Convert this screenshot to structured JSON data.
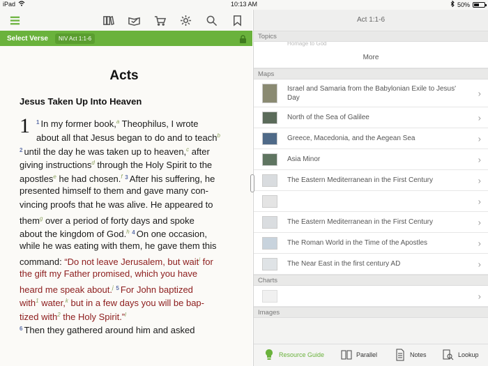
{
  "status": {
    "device": "iPad",
    "time": "10:13 AM",
    "battery": "50%",
    "battery_level": 0.5
  },
  "toolbar": {
    "icons": [
      "menu-icon",
      "library-icon",
      "reading-plan-icon",
      "cart-icon",
      "settings-icon",
      "search-icon",
      "bookmark-icon"
    ]
  },
  "verse_bar": {
    "select_label": "Select Verse",
    "reference": "NIV Act 1:1-6"
  },
  "reader": {
    "book_title": "Acts",
    "section_heading": "Jesus Taken Up Into Heaven",
    "chapter_number": "1",
    "lines": [
      [
        {
          "t": "v",
          "x": "1"
        },
        {
          "t": "n",
          "x": "In my former book,"
        },
        {
          "t": "f",
          "x": "a"
        },
        {
          "t": "n",
          "x": " Theophilus, I wrote"
        }
      ],
      [
        {
          "t": "n",
          "x": "about all that Jesus began to do and to teach"
        },
        {
          "t": "f",
          "x": "b"
        }
      ],
      [
        {
          "t": "v",
          "x": "2"
        },
        {
          "t": "n",
          "x": "until the day he was taken up to heaven,"
        },
        {
          "t": "f",
          "x": "c"
        },
        {
          "t": "n",
          "x": " after"
        }
      ],
      [
        {
          "t": "n",
          "x": "giving instructions"
        },
        {
          "t": "f",
          "x": "d"
        },
        {
          "t": "n",
          "x": " through the Holy Spirit to the"
        }
      ],
      [
        {
          "t": "n",
          "x": "apostles"
        },
        {
          "t": "f",
          "x": "e"
        },
        {
          "t": "n",
          "x": " he had chosen."
        },
        {
          "t": "f",
          "x": "f"
        },
        {
          "t": "n",
          "x": "  "
        },
        {
          "t": "v",
          "x": "3"
        },
        {
          "t": "n",
          "x": "After his suffering, he"
        }
      ],
      [
        {
          "t": "n",
          "x": "presented himself to them and gave many con-"
        }
      ],
      [
        {
          "t": "n",
          "x": "vincing proofs that he was alive. He appeared to"
        }
      ],
      [
        {
          "t": "n",
          "x": "them"
        },
        {
          "t": "f",
          "x": "g"
        },
        {
          "t": "n",
          "x": " over a period of forty days and spoke"
        }
      ],
      [
        {
          "t": "n",
          "x": "about the kingdom of God."
        },
        {
          "t": "f",
          "x": "h"
        },
        {
          "t": "n",
          "x": "  "
        },
        {
          "t": "v",
          "x": "4"
        },
        {
          "t": "n",
          "x": "On one occasion,"
        }
      ],
      [
        {
          "t": "n",
          "x": "while he was eating with them, he gave them this"
        }
      ],
      [
        {
          "t": "n",
          "x": "command: "
        },
        {
          "t": "r",
          "x": "“Do not leave Jerusalem, but wait"
        },
        {
          "t": "f",
          "x": "i"
        },
        {
          "t": "r",
          "x": " for"
        }
      ],
      [
        {
          "t": "r",
          "x": "the gift my Father promised, which you have"
        }
      ],
      [
        {
          "t": "r",
          "x": "heard me speak about."
        },
        {
          "t": "f",
          "x": "j"
        },
        {
          "t": "n",
          "x": "  "
        },
        {
          "t": "v",
          "x": "5"
        },
        {
          "t": "r",
          "x": "For John baptized"
        }
      ],
      [
        {
          "t": "r",
          "x": "with"
        },
        {
          "t": "f",
          "x": "1"
        },
        {
          "t": "r",
          "x": " water,"
        },
        {
          "t": "f",
          "x": "k"
        },
        {
          "t": "r",
          "x": " but in a few days you will be bap-"
        }
      ],
      [
        {
          "t": "r",
          "x": "tized with"
        },
        {
          "t": "f",
          "x": "2"
        },
        {
          "t": "r",
          "x": " the Holy Spirit.”"
        },
        {
          "t": "f",
          "x": "l"
        }
      ],
      [
        {
          "t": "n",
          "x": "      "
        },
        {
          "t": "v",
          "x": "6"
        },
        {
          "t": "n",
          "x": "Then they gathered around him and asked"
        }
      ]
    ]
  },
  "resource_pane": {
    "header": "Act 1:1-6",
    "topics_label": "Topics",
    "topic_partial": "Homage to God",
    "more_label": "More",
    "maps_label": "Maps",
    "maps": [
      {
        "title": "Israel and Samaria from the Babylonian Exile to Jesus' Day",
        "thumb": "#8a8a72"
      },
      {
        "title": "North of the Sea of Galilee",
        "thumb": "#5b6b5a"
      },
      {
        "title": "Greece, Macedonia, and the Aegean Sea",
        "thumb": "#4f6a88"
      },
      {
        "title": "Asia Minor",
        "thumb": "#5f7561"
      },
      {
        "title": "The Eastern Mediterranean in the First Century",
        "thumb": "#d9dcdf"
      },
      {
        "title": "",
        "thumb": "#e4e4e4"
      },
      {
        "title": "The Eastern Mediterranean in the First Century",
        "thumb": "#dadde0"
      },
      {
        "title": "The Roman World in the Time of the Apostles",
        "thumb": "#c8d3dd"
      },
      {
        "title": "The Near East in the first century AD",
        "thumb": "#dfe3e6"
      }
    ],
    "charts_label": "Charts",
    "images_label": "Images"
  },
  "bottom_bar": {
    "resource_guide": "Resource Guide",
    "parallel": "Parallel",
    "notes": "Notes",
    "lookup": "Lookup"
  },
  "colors": {
    "accent": "#6ab23c",
    "verse_number": "#5d6fa8",
    "words_of_christ": "#8c1c1c"
  }
}
